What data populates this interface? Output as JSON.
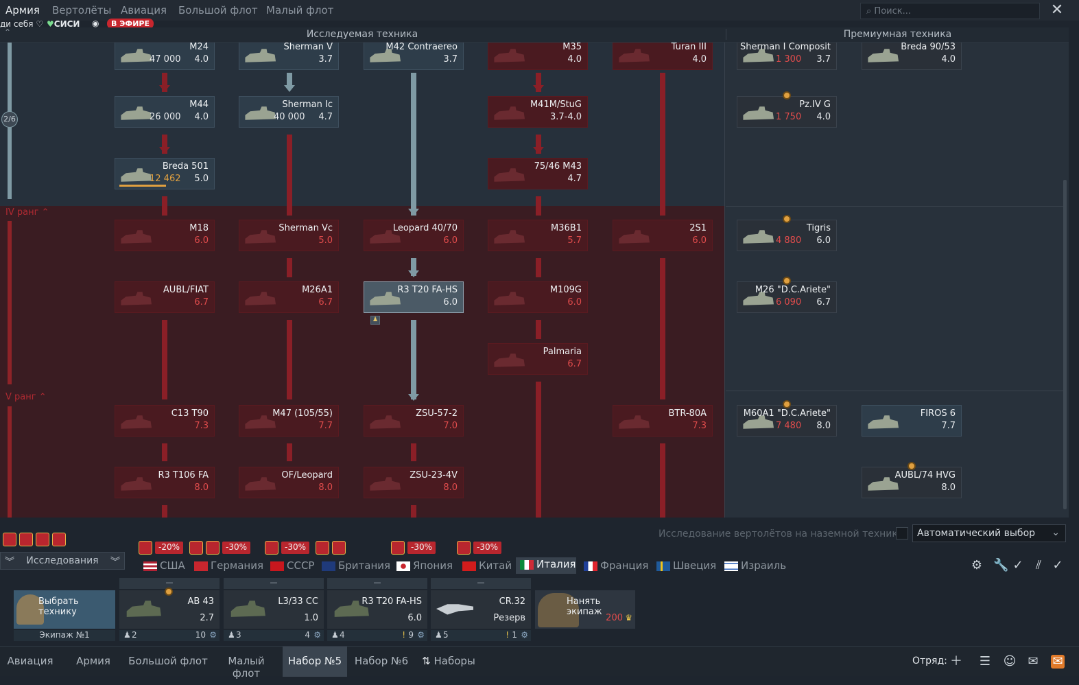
{
  "top_tabs": [
    "Армия",
    "Вертолёты",
    "Авиация",
    "Большой флот",
    "Малый флот"
  ],
  "search": {
    "placeholder": "Поиск..."
  },
  "sub": {
    "left": "ди себя ♡",
    "sisi": "СИСИ",
    "live": "В ЭФИРЕ"
  },
  "header": {
    "researched": "Исследуемая техника",
    "premium": "Премиумная техника"
  },
  "rank_counter": "2/6",
  "ranks": {
    "r4": "IV ранг",
    "r5": "V ранг"
  },
  "cards": [
    {
      "name": "M24",
      "br": "4.0",
      "cost": "47 000"
    },
    {
      "name": "Sherman V",
      "br": "3.7"
    },
    {
      "name": "M42 Contraereo",
      "br": "3.7"
    },
    {
      "name": "M35",
      "br": "4.0"
    },
    {
      "name": "Turan III",
      "br": "4.0"
    },
    {
      "name": "Sherman I Composit",
      "br": "3.7",
      "cost": "1 300"
    },
    {
      "name": "Breda 90/53",
      "br": "4.0"
    },
    {
      "name": "M44",
      "br": "4.0",
      "cost": "26 000"
    },
    {
      "name": "Sherman Ic",
      "br": "4.7",
      "cost": "40 000"
    },
    {
      "name": "M41M/StuG",
      "br": "3.7-4.0"
    },
    {
      "name": "Pz.IV G",
      "br": "4.0",
      "cost": "1 750"
    },
    {
      "name": "Breda 501",
      "br": "5.0",
      "cost": "12 462"
    },
    {
      "name": "75/46 M43",
      "br": "4.7"
    },
    {
      "name": "M18",
      "br": "6.0"
    },
    {
      "name": "Sherman Vc",
      "br": "5.0"
    },
    {
      "name": "Leopard 40/70",
      "br": "6.0"
    },
    {
      "name": "M36B1",
      "br": "5.7"
    },
    {
      "name": "2S1",
      "br": "6.0"
    },
    {
      "name": "Tigris",
      "br": "6.0",
      "cost": "4 880"
    },
    {
      "name": "AUBL/FIAT",
      "br": "6.7"
    },
    {
      "name": "M26A1",
      "br": "6.7"
    },
    {
      "name": "R3 T20 FA-HS",
      "br": "6.0"
    },
    {
      "name": "M109G",
      "br": "6.0"
    },
    {
      "name": "M26 \"D.C.Ariete\"",
      "br": "6.7",
      "cost": "6 090"
    },
    {
      "name": "Palmaria",
      "br": "6.7"
    },
    {
      "name": "C13 T90",
      "br": "7.3"
    },
    {
      "name": "M47 (105/55)",
      "br": "7.7"
    },
    {
      "name": "ZSU-57-2",
      "br": "7.0"
    },
    {
      "name": "BTR-80A",
      "br": "7.3"
    },
    {
      "name": "M60A1 \"D.C.Ariete\"",
      "br": "8.0",
      "cost": "7 480"
    },
    {
      "name": "FIROS 6",
      "br": "7.7"
    },
    {
      "name": "R3 T106 FA",
      "br": "8.0"
    },
    {
      "name": "OF/Leopard",
      "br": "8.0"
    },
    {
      "name": "ZSU-23-4V",
      "br": "8.0"
    },
    {
      "name": "AUBL/74 HVG",
      "br": "8.0"
    }
  ],
  "auto": {
    "label": "Исследование вертолётов на наземной технике",
    "select": "Автоматический выбор"
  },
  "discounts": [
    "-20%",
    "-30%",
    "-30%",
    "-30%",
    "-30%"
  ],
  "research_btn": "Исследования",
  "nations": [
    "США",
    "Германия",
    "СССР",
    "Британия",
    "Япония",
    "Китай",
    "Италия",
    "Франция",
    "Швеция",
    "Израиль"
  ],
  "crew": {
    "choose": "Выбрать технику",
    "crew_label": "Экипаж №1",
    "hire": "Нанять экипаж",
    "hire_cost": "200"
  },
  "slots": [
    {
      "name": "AB 43",
      "br": "2.7",
      "num": "2",
      "lvl": "10"
    },
    {
      "name": "L3/33 CC",
      "br": "1.0",
      "num": "3",
      "lvl": "4"
    },
    {
      "name": "R3 T20 FA-HS",
      "br": "6.0",
      "num": "4",
      "lvl": "9"
    },
    {
      "name": "CR.32",
      "br": "Резерв",
      "num": "5",
      "lvl": "1"
    }
  ],
  "bottom_tabs": [
    "Авиация",
    "Армия",
    "Большой флот",
    "Малый флот",
    "Набор №5",
    "Набор №6",
    "Наборы"
  ],
  "squad": "Отряд:"
}
